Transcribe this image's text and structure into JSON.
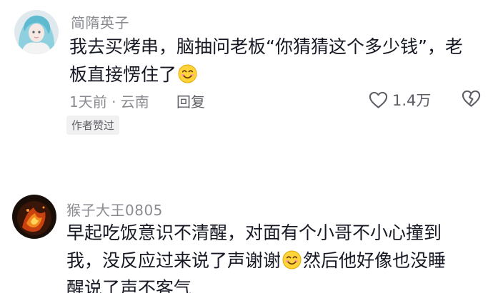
{
  "comments": [
    {
      "username": "简隋英子",
      "line1_text": "我去买烤串，脑抽问老板“你猜猜这个多少钱”，老",
      "line2_text": "板直接愣住了",
      "emoji": "smile-emoji",
      "time_location": "1天前 · 云南",
      "reply_label": "回复",
      "like_count": "1.4万",
      "badge": "作者赞过"
    },
    {
      "username": "猴子大王0805",
      "line1_text": "早起吃饭意识不清醒，对面有个小哥不小心撞到",
      "line2_before": "我，没反应过来说了声谢谢",
      "emoji": "smile-emoji",
      "line2_after": "然后他好像也没睡",
      "line3_text": "醒说了声不客气"
    }
  ],
  "colors": {
    "primary_text": "#161823",
    "secondary_text": "#8a8b91",
    "badge_bg": "#f1f1f2"
  },
  "icons": [
    "heart-outline-icon",
    "broken-heart-icon",
    "smile-emoji"
  ]
}
